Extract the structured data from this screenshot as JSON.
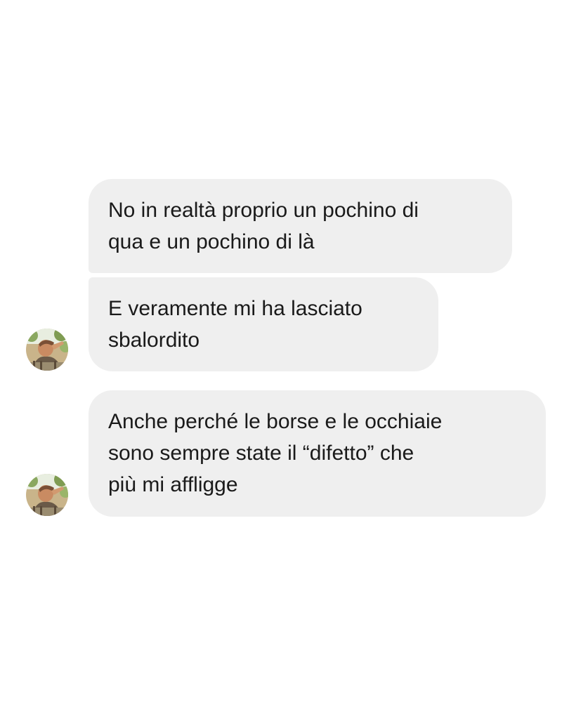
{
  "conversation": {
    "messages": [
      {
        "sender": "other",
        "lines": [
          "No in realtà proprio un pochino di",
          "qua e un pochino di là"
        ],
        "show_avatar": false
      },
      {
        "sender": "other",
        "lines": [
          "E veramente mi ha lasciato",
          "sbalordito"
        ],
        "show_avatar": true,
        "avatar_icon": "profile-photo-icon"
      },
      {
        "sender": "other",
        "lines": [
          "Anche perché le borse e le occhiaie",
          "sono sempre state il “difetto” che",
          "più mi affligge"
        ],
        "show_avatar": true,
        "avatar_icon": "profile-photo-icon"
      }
    ]
  },
  "colors": {
    "background": "#ffffff",
    "bubble": "#efefef",
    "text": "#1a1a1a"
  }
}
